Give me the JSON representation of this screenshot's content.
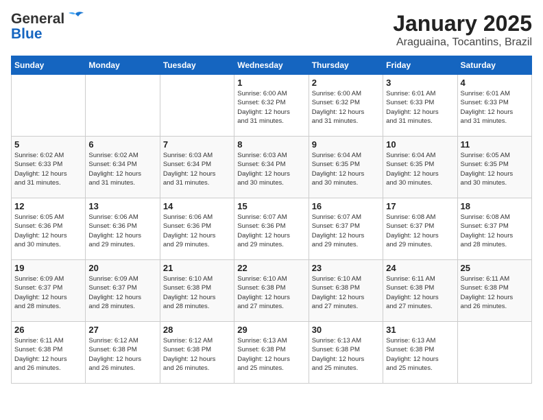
{
  "header": {
    "logo_line1": "General",
    "logo_line2": "Blue",
    "title": "January 2025",
    "subtitle": "Araguaina, Tocantins, Brazil"
  },
  "calendar": {
    "days_of_week": [
      "Sunday",
      "Monday",
      "Tuesday",
      "Wednesday",
      "Thursday",
      "Friday",
      "Saturday"
    ],
    "weeks": [
      [
        {
          "day": "",
          "info": ""
        },
        {
          "day": "",
          "info": ""
        },
        {
          "day": "",
          "info": ""
        },
        {
          "day": "1",
          "info": "Sunrise: 6:00 AM\nSunset: 6:32 PM\nDaylight: 12 hours\nand 31 minutes."
        },
        {
          "day": "2",
          "info": "Sunrise: 6:00 AM\nSunset: 6:32 PM\nDaylight: 12 hours\nand 31 minutes."
        },
        {
          "day": "3",
          "info": "Sunrise: 6:01 AM\nSunset: 6:33 PM\nDaylight: 12 hours\nand 31 minutes."
        },
        {
          "day": "4",
          "info": "Sunrise: 6:01 AM\nSunset: 6:33 PM\nDaylight: 12 hours\nand 31 minutes."
        }
      ],
      [
        {
          "day": "5",
          "info": "Sunrise: 6:02 AM\nSunset: 6:33 PM\nDaylight: 12 hours\nand 31 minutes."
        },
        {
          "day": "6",
          "info": "Sunrise: 6:02 AM\nSunset: 6:34 PM\nDaylight: 12 hours\nand 31 minutes."
        },
        {
          "day": "7",
          "info": "Sunrise: 6:03 AM\nSunset: 6:34 PM\nDaylight: 12 hours\nand 31 minutes."
        },
        {
          "day": "8",
          "info": "Sunrise: 6:03 AM\nSunset: 6:34 PM\nDaylight: 12 hours\nand 30 minutes."
        },
        {
          "day": "9",
          "info": "Sunrise: 6:04 AM\nSunset: 6:35 PM\nDaylight: 12 hours\nand 30 minutes."
        },
        {
          "day": "10",
          "info": "Sunrise: 6:04 AM\nSunset: 6:35 PM\nDaylight: 12 hours\nand 30 minutes."
        },
        {
          "day": "11",
          "info": "Sunrise: 6:05 AM\nSunset: 6:35 PM\nDaylight: 12 hours\nand 30 minutes."
        }
      ],
      [
        {
          "day": "12",
          "info": "Sunrise: 6:05 AM\nSunset: 6:36 PM\nDaylight: 12 hours\nand 30 minutes."
        },
        {
          "day": "13",
          "info": "Sunrise: 6:06 AM\nSunset: 6:36 PM\nDaylight: 12 hours\nand 29 minutes."
        },
        {
          "day": "14",
          "info": "Sunrise: 6:06 AM\nSunset: 6:36 PM\nDaylight: 12 hours\nand 29 minutes."
        },
        {
          "day": "15",
          "info": "Sunrise: 6:07 AM\nSunset: 6:36 PM\nDaylight: 12 hours\nand 29 minutes."
        },
        {
          "day": "16",
          "info": "Sunrise: 6:07 AM\nSunset: 6:37 PM\nDaylight: 12 hours\nand 29 minutes."
        },
        {
          "day": "17",
          "info": "Sunrise: 6:08 AM\nSunset: 6:37 PM\nDaylight: 12 hours\nand 29 minutes."
        },
        {
          "day": "18",
          "info": "Sunrise: 6:08 AM\nSunset: 6:37 PM\nDaylight: 12 hours\nand 28 minutes."
        }
      ],
      [
        {
          "day": "19",
          "info": "Sunrise: 6:09 AM\nSunset: 6:37 PM\nDaylight: 12 hours\nand 28 minutes."
        },
        {
          "day": "20",
          "info": "Sunrise: 6:09 AM\nSunset: 6:37 PM\nDaylight: 12 hours\nand 28 minutes."
        },
        {
          "day": "21",
          "info": "Sunrise: 6:10 AM\nSunset: 6:38 PM\nDaylight: 12 hours\nand 28 minutes."
        },
        {
          "day": "22",
          "info": "Sunrise: 6:10 AM\nSunset: 6:38 PM\nDaylight: 12 hours\nand 27 minutes."
        },
        {
          "day": "23",
          "info": "Sunrise: 6:10 AM\nSunset: 6:38 PM\nDaylight: 12 hours\nand 27 minutes."
        },
        {
          "day": "24",
          "info": "Sunrise: 6:11 AM\nSunset: 6:38 PM\nDaylight: 12 hours\nand 27 minutes."
        },
        {
          "day": "25",
          "info": "Sunrise: 6:11 AM\nSunset: 6:38 PM\nDaylight: 12 hours\nand 26 minutes."
        }
      ],
      [
        {
          "day": "26",
          "info": "Sunrise: 6:11 AM\nSunset: 6:38 PM\nDaylight: 12 hours\nand 26 minutes."
        },
        {
          "day": "27",
          "info": "Sunrise: 6:12 AM\nSunset: 6:38 PM\nDaylight: 12 hours\nand 26 minutes."
        },
        {
          "day": "28",
          "info": "Sunrise: 6:12 AM\nSunset: 6:38 PM\nDaylight: 12 hours\nand 26 minutes."
        },
        {
          "day": "29",
          "info": "Sunrise: 6:13 AM\nSunset: 6:38 PM\nDaylight: 12 hours\nand 25 minutes."
        },
        {
          "day": "30",
          "info": "Sunrise: 6:13 AM\nSunset: 6:38 PM\nDaylight: 12 hours\nand 25 minutes."
        },
        {
          "day": "31",
          "info": "Sunrise: 6:13 AM\nSunset: 6:38 PM\nDaylight: 12 hours\nand 25 minutes."
        },
        {
          "day": "",
          "info": ""
        }
      ]
    ]
  }
}
